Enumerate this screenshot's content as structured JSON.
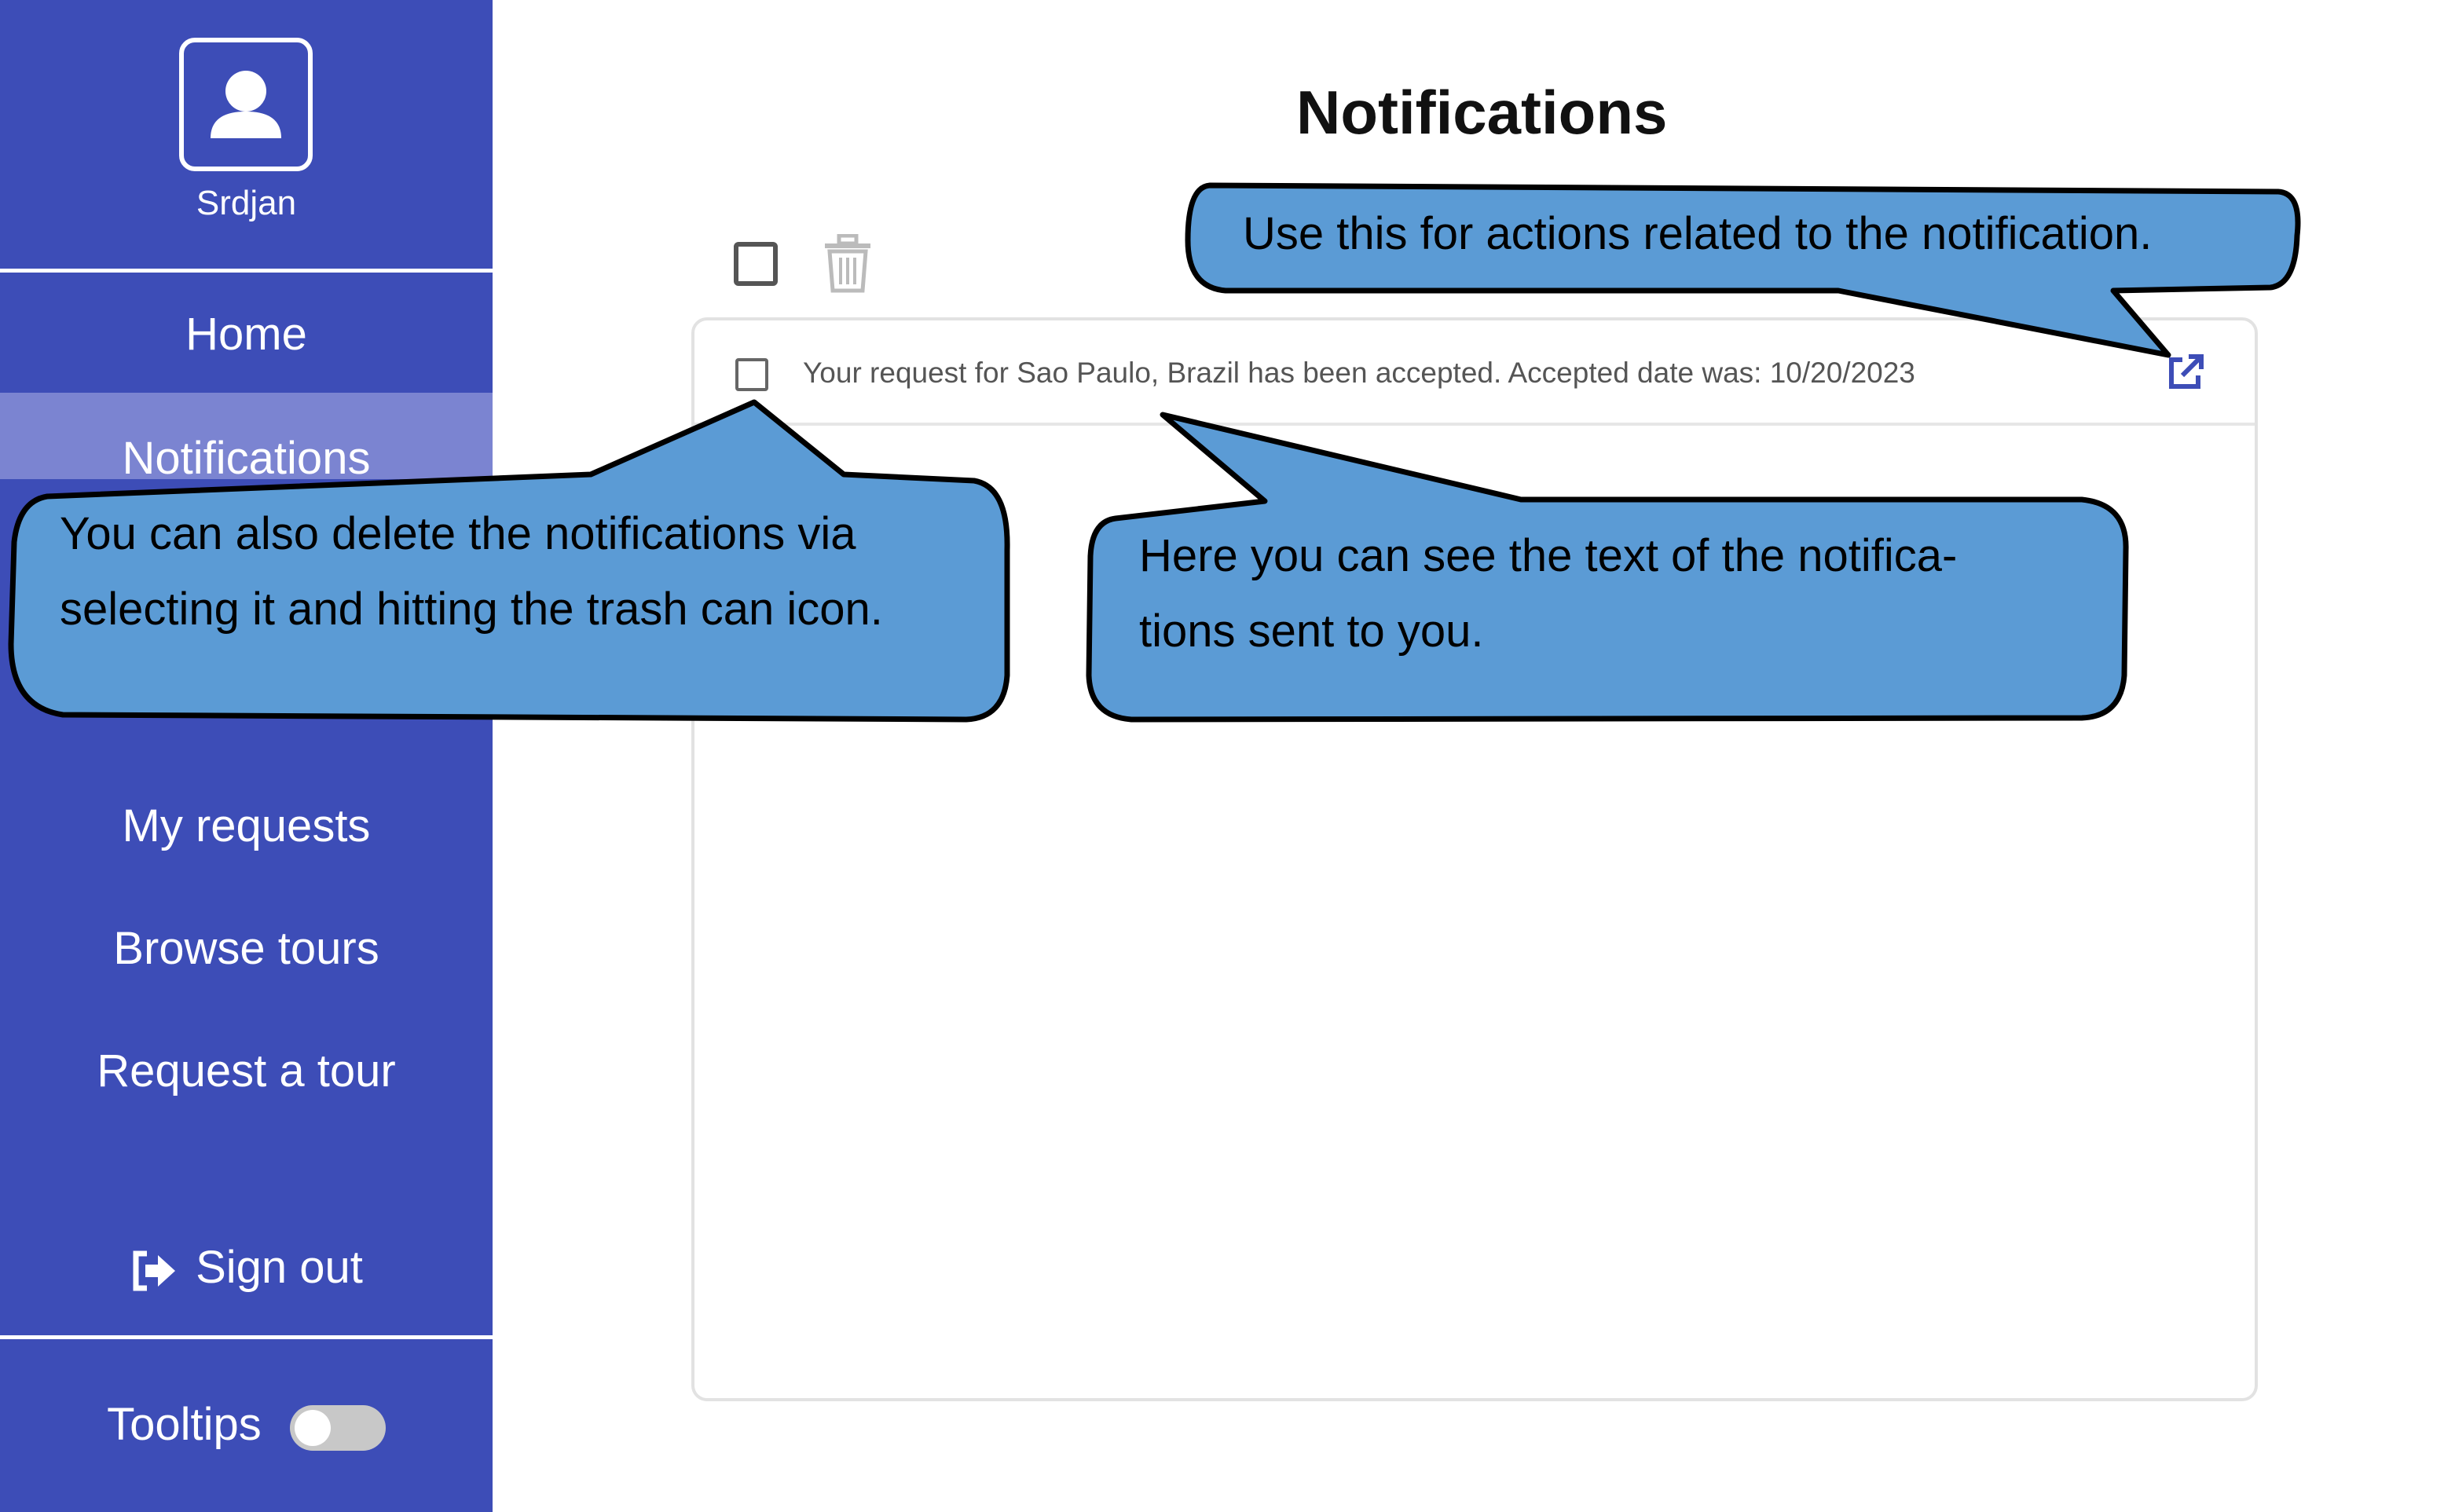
{
  "sidebar": {
    "username": "Srdjan",
    "items": [
      {
        "label": "Home"
      },
      {
        "label": "Notifications"
      },
      {
        "label": "My requests"
      },
      {
        "label": "Browse tours"
      },
      {
        "label": "Request a tour"
      }
    ],
    "sign_out": "Sign out",
    "tooltips_label": "Tooltips"
  },
  "main": {
    "title": "Notifications",
    "notifications": [
      {
        "text": "Your request for Sao Paulo, Brazil has been accepted. Accepted date was: 10/20/2023"
      }
    ]
  },
  "callouts": {
    "actions": "Use this for actions related to the notification.",
    "delete_line1": "You can also delete the notifications via",
    "delete_line2": "selecting it and hitting the trash can icon.",
    "text_line1": "Here you can see the text of the notifica-",
    "text_line2": "tions sent to you."
  },
  "colors": {
    "sidebar": "#3d4db7",
    "active_item": "#7b84d1",
    "callout_fill": "#5b9bd5",
    "accent": "#3d4db7"
  }
}
